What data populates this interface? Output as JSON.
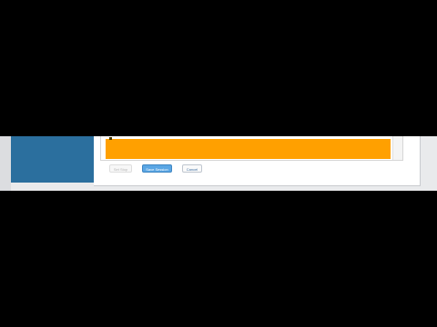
{
  "buttons": {
    "disabled_label": "Set Stop",
    "primary_label": "Save Session",
    "secondary_label": "Cancel"
  },
  "colors": {
    "side_panel": "#2b6f9e",
    "highlight_band": "#ffa000",
    "primary_button": "#5aa6e4"
  }
}
